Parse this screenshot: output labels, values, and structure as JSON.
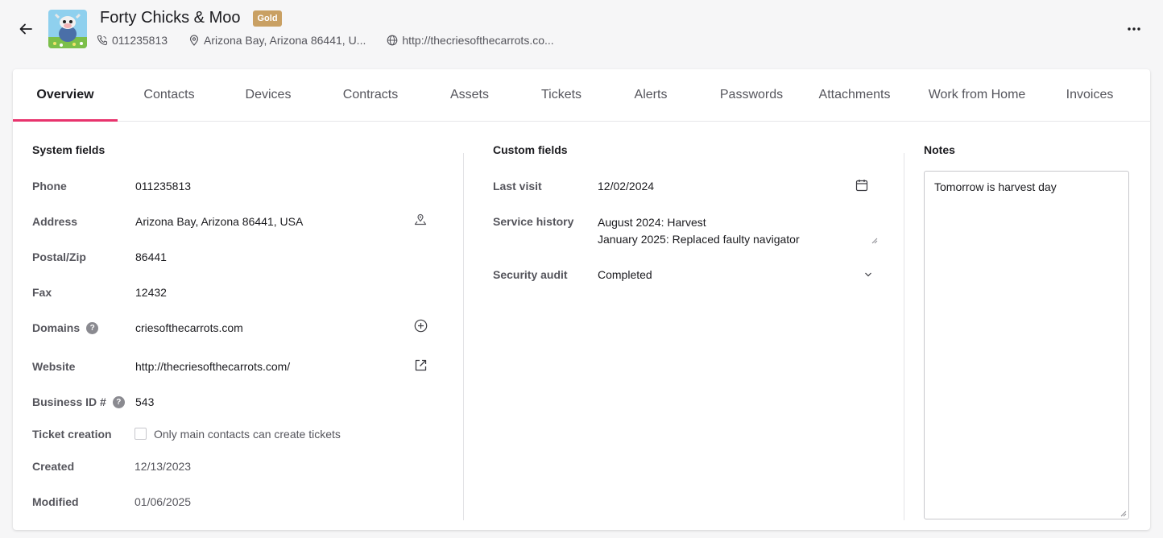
{
  "header": {
    "title": "Forty Chicks & Moo",
    "badge": "Gold",
    "phone": "011235813",
    "address": "Arizona Bay, Arizona 86441, U...",
    "website": "http://thecriesofthecarrots.co..."
  },
  "tabs": [
    "Overview",
    "Contacts",
    "Devices",
    "Contracts",
    "Assets",
    "Tickets",
    "Alerts",
    "Passwords",
    "Attachments",
    "Work from Home",
    "Invoices"
  ],
  "system_fields": {
    "title": "System fields",
    "phone": {
      "label": "Phone",
      "value": "011235813"
    },
    "address": {
      "label": "Address",
      "value": "Arizona Bay, Arizona 86441, USA"
    },
    "postal": {
      "label": "Postal/Zip",
      "value": "86441"
    },
    "fax": {
      "label": "Fax",
      "value": "12432"
    },
    "domains": {
      "label": "Domains",
      "value": "criesofthecarrots.com"
    },
    "website": {
      "label": "Website",
      "value": "http://thecriesofthecarrots.com/"
    },
    "business_id": {
      "label": "Business ID #",
      "value": "543"
    },
    "ticket_creation": {
      "label": "Ticket creation",
      "value": "Only main contacts can create tickets"
    },
    "created": {
      "label": "Created",
      "value": "12/13/2023"
    },
    "modified": {
      "label": "Modified",
      "value": "01/06/2025"
    }
  },
  "custom_fields": {
    "title": "Custom fields",
    "last_visit": {
      "label": "Last visit",
      "value": "12/02/2024"
    },
    "service_history": {
      "label": "Service history",
      "line1": "August 2024: Harvest",
      "line2": "January 2025: Replaced faulty navigator"
    },
    "security_audit": {
      "label": "Security audit",
      "value": "Completed"
    }
  },
  "notes": {
    "title": "Notes",
    "text": "Tomorrow is harvest day"
  },
  "colors": {
    "accent": "#e8336d",
    "badge": "#c9a063"
  }
}
